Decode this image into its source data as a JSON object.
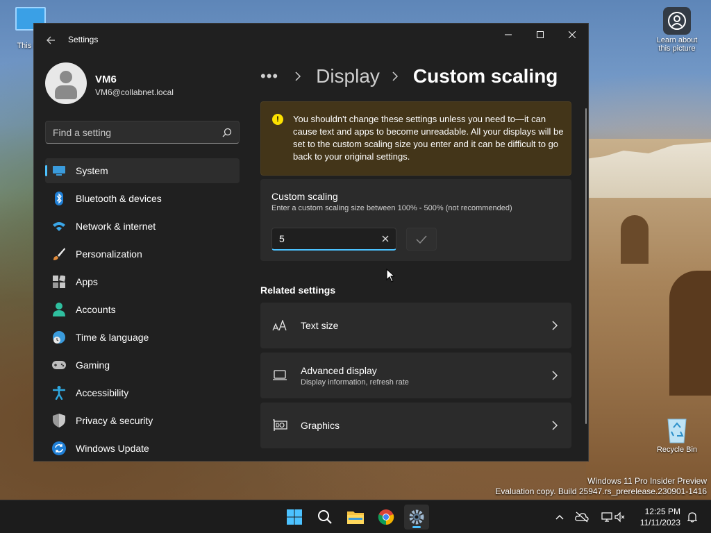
{
  "desktop": {
    "icons": [
      {
        "label": "This PC"
      },
      {
        "label": "Learn about this picture"
      },
      {
        "label": "Recycle Bin"
      }
    ],
    "watermark": {
      "line1": "Windows 11 Pro Insider Preview",
      "line2": "Evaluation copy. Build 25947.rs_prerelease.230901-1416"
    }
  },
  "window": {
    "title": "Settings",
    "controls": {
      "minimize": "minimize",
      "maximize": "maximize",
      "close": "close"
    }
  },
  "profile": {
    "name": "VM6",
    "email": "VM6@collabnet.local"
  },
  "search": {
    "placeholder": "Find a setting"
  },
  "nav": {
    "items": [
      {
        "label": "System",
        "icon": "monitor-icon",
        "active": true
      },
      {
        "label": "Bluetooth & devices",
        "icon": "bluetooth-icon"
      },
      {
        "label": "Network & internet",
        "icon": "wifi-icon"
      },
      {
        "label": "Personalization",
        "icon": "brush-icon"
      },
      {
        "label": "Apps",
        "icon": "apps-icon"
      },
      {
        "label": "Accounts",
        "icon": "person-icon"
      },
      {
        "label": "Time & language",
        "icon": "globe-clock-icon"
      },
      {
        "label": "Gaming",
        "icon": "gamepad-icon"
      },
      {
        "label": "Accessibility",
        "icon": "accessibility-icon"
      },
      {
        "label": "Privacy & security",
        "icon": "shield-icon"
      },
      {
        "label": "Windows Update",
        "icon": "update-icon"
      }
    ]
  },
  "breadcrumb": {
    "more": "•••",
    "parent": "Display",
    "current": "Custom scaling"
  },
  "warning": {
    "text": "You shouldn't change these settings unless you need to—it can cause text and apps to become unreadable. All your displays will be set to the custom scaling size you enter and it can be difficult to go back to your original settings."
  },
  "custom_scaling": {
    "title": "Custom scaling",
    "subtitle": "Enter a custom scaling size between 100% - 500% (not recommended)",
    "value": "5"
  },
  "related": {
    "title": "Related settings",
    "items": [
      {
        "title": "Text size",
        "subtitle": "",
        "icon": "text-size-icon"
      },
      {
        "title": "Advanced display",
        "subtitle": "Display information, refresh rate",
        "icon": "laptop-icon"
      },
      {
        "title": "Graphics",
        "subtitle": "",
        "icon": "gpu-icon"
      }
    ]
  },
  "taskbar": {
    "apps": [
      "start",
      "search",
      "file-explorer",
      "chrome",
      "settings"
    ],
    "clock": {
      "time": "12:25 PM",
      "date": "11/11/2023"
    }
  },
  "colors": {
    "accent": "#4cc2ff",
    "warning_bg": "#433519",
    "warning_icon": "#fce100",
    "window_bg": "#202020",
    "card_bg": "#2b2b2b"
  }
}
